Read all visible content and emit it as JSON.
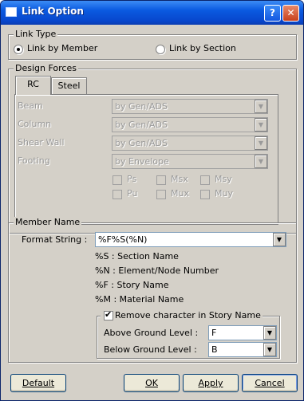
{
  "window": {
    "title": "Link Option",
    "help_label": "?",
    "close_label": "✕"
  },
  "link_type": {
    "title": "Link Type",
    "options": [
      {
        "label": "Link by Member",
        "selected": true
      },
      {
        "label": "Link by Section",
        "selected": false
      }
    ]
  },
  "design_forces": {
    "title": "Design Forces",
    "tabs": [
      {
        "label": "RC",
        "active": true
      },
      {
        "label": "Steel",
        "active": false
      }
    ],
    "rows": [
      {
        "label": "Beam",
        "value": "by Gen/ADS"
      },
      {
        "label": "Column",
        "value": "by Gen/ADS"
      },
      {
        "label": "Shear Wall",
        "value": "by Gen/ADS"
      },
      {
        "label": "Footing",
        "value": "by Envelope"
      }
    ],
    "checks": [
      "Ps",
      "Msx",
      "Msy",
      "Pu",
      "Mux",
      "Muy"
    ]
  },
  "member_name": {
    "title": "Member Name",
    "format_label": "Format String :",
    "format_value": "%F%S(%N)",
    "legend": [
      "%S : Section Name",
      "%N : Element/Node Number",
      "%F : Story Name",
      "%M : Material Name"
    ],
    "remove_label": "Remove character in Story Name",
    "remove_checked": true,
    "above_label": "Above Ground Level :",
    "above_value": "F",
    "below_label": "Below Ground Level :",
    "below_value": "B"
  },
  "buttons": {
    "default": "Default",
    "ok": "OK",
    "apply": "Apply",
    "cancel": "Cancel"
  }
}
